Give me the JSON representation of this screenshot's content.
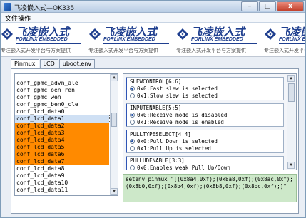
{
  "window": {
    "title": "飞凌嵌入式—OK335",
    "buttons": {
      "minimize": "–",
      "maximize": "□",
      "close": "x"
    }
  },
  "menu": {
    "items": [
      "文件操作"
    ]
  },
  "banner": {
    "logo_cn": "飞凌嵌入式",
    "logo_en": "FORLINX EMBEDDED",
    "tagline": "专注嵌入式开发平台与方案提供",
    "brand_color": "#1f3f8f"
  },
  "tabs": [
    {
      "label": "Pinmux",
      "active": true
    },
    {
      "label": "LCD",
      "active": false
    },
    {
      "label": "uboot.env",
      "active": false
    }
  ],
  "pin_list": {
    "items": [
      "conf_gpmc_advn_ale",
      "conf_gpmc_oen_ren",
      "conf_gpmc_wen",
      "conf_gpmc_ben0_cle",
      "conf_lcd_data0",
      "conf_lcd_data1",
      "conf_lcd_data2",
      "conf_lcd_data3",
      "conf_lcd_data4",
      "conf_lcd_data5",
      "conf_lcd_data6",
      "conf_lcd_data7",
      "conf_lcd_data8",
      "conf_lcd_data9",
      "conf_lcd_data10",
      "conf_lcd_data11"
    ],
    "highlight_color": "#ff8a00"
  },
  "properties": {
    "groups": [
      {
        "title": "SLEWCONTROL[6:6]",
        "options": [
          "0x0:Fast slew is selected",
          "0x1:Slow slew is selected"
        ],
        "selected": 0
      },
      {
        "title": "INPUTENABLE[5:5]",
        "options": [
          "0x0:Receive mode is disabled",
          "0x1:Receive mode is enabled"
        ],
        "selected": 0
      },
      {
        "title": "PULLTYPESELECT[4:4]",
        "options": [
          "0x0:Pull Down is selected",
          "0x1:Pull Up is selected"
        ],
        "selected": 0
      },
      {
        "title": "PULLUDENABLE[3:3]",
        "options": [
          "0x0:Enables weak Pull Up/Down"
        ],
        "selected": 0
      }
    ]
  },
  "output": {
    "lines": [
      "setenv pinmux \"[(0x8a4,0xf);(0x8a8,0xf);(0x8ac,0xf);",
      "(0x8b0,0xf);(0x8b4,0xf);(0x8b8,0xf);(0x8bc,0xf);]\""
    ]
  }
}
